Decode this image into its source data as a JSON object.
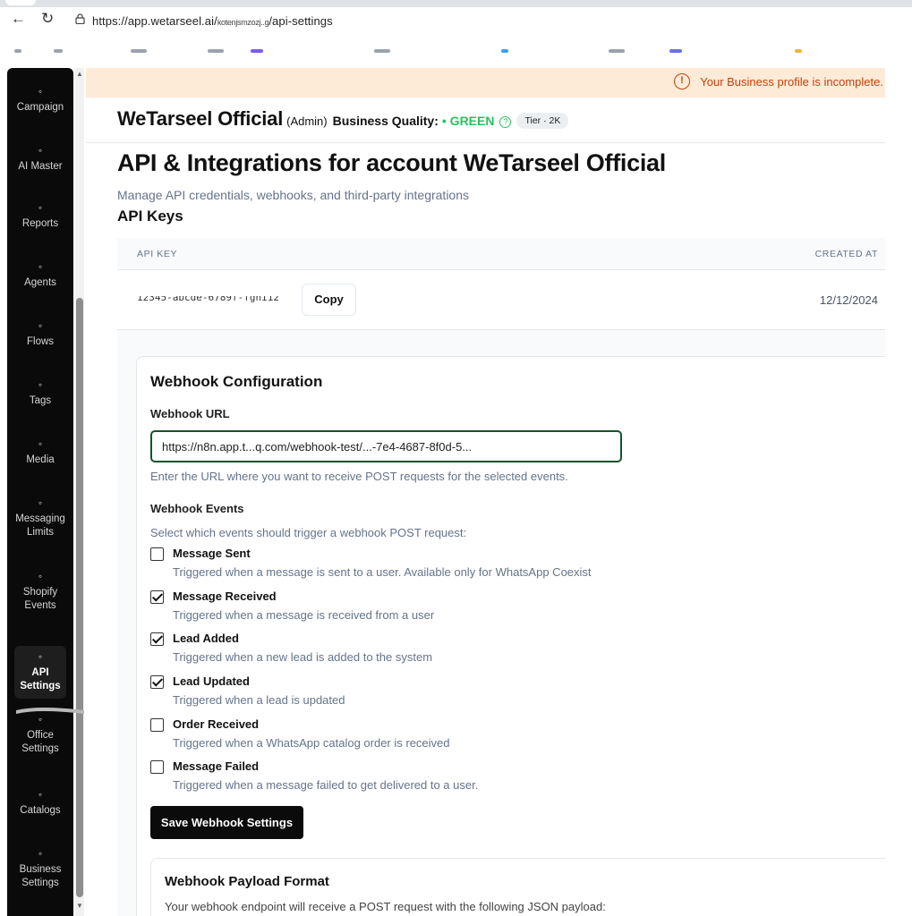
{
  "browser": {
    "url_host": "https://app.wetarseel.ai/",
    "url_mid": "kotenjsmzozj..g",
    "url_path": "/api-settings",
    "back_icon": "arrow-left",
    "reload_icon": "reload"
  },
  "sidebar": {
    "items": [
      {
        "label": "Campaign",
        "icon": "megaphone-icon"
      },
      {
        "label": "AI Master",
        "icon": "robot-icon"
      },
      {
        "label": "Reports",
        "icon": "report-icon"
      },
      {
        "label": "Agents",
        "icon": "agent-icon"
      },
      {
        "label": "Flows",
        "icon": "flow-icon"
      },
      {
        "label": "Tags",
        "icon": "tag-icon"
      },
      {
        "label": "Media",
        "icon": "image-icon"
      },
      {
        "label": "Messaging Limits",
        "icon": "chat-icon"
      },
      {
        "label": "Shopify Events",
        "icon": "bag-icon"
      },
      {
        "label": "API Settings",
        "icon": "plug-icon",
        "active": true
      },
      {
        "label": "Office Settings",
        "icon": "plug-icon"
      },
      {
        "label": "Catalogs",
        "icon": "store-icon"
      },
      {
        "label": "Business Settings",
        "icon": "gear-icon"
      }
    ]
  },
  "banner": {
    "text": "Your Business profile is incomplete."
  },
  "header": {
    "org": "WeTarseel Official",
    "role": "(Admin)",
    "quality_label": "Business Quality:",
    "quality_value": "• GREEN",
    "tier": "Tier · 2K"
  },
  "page": {
    "title": "API & Integrations for account WeTarseel Official",
    "subtitle": "Manage API credentials, webhooks, and third-party integrations",
    "api_keys_heading": "API Keys"
  },
  "api_table": {
    "col_key": "API KEY",
    "col_created": "CREATED AT",
    "rows": [
      {
        "key": "12345-abcde-6789f-fghi12",
        "copy_label": "Copy",
        "created": "12/12/2024"
      }
    ]
  },
  "webhook": {
    "title": "Webhook Configuration",
    "url_label": "Webhook URL",
    "url_value": "https://n8n.app.t...q.com/webhook-test/...-7e4-4687-8f0d-5...",
    "url_hint": "Enter the URL where you want to receive POST requests for the selected events.",
    "events_label": "Webhook Events",
    "events_hint": "Select which events should trigger a webhook POST request:",
    "events": [
      {
        "name": "Message Sent",
        "desc": "Triggered when a message is sent to a user. Available only for WhatsApp Coexist",
        "checked": false
      },
      {
        "name": "Message Received",
        "desc": "Triggered when a message is received from a user",
        "checked": true
      },
      {
        "name": "Lead Added",
        "desc": "Triggered when a new lead is added to the system",
        "checked": true
      },
      {
        "name": "Lead Updated",
        "desc": "Triggered when a lead is updated",
        "checked": true
      },
      {
        "name": "Order Received",
        "desc": "Triggered when a WhatsApp catalog order is received",
        "checked": false
      },
      {
        "name": "Message Failed",
        "desc": "Triggered when a message failed to get delivered to a user.",
        "checked": false
      }
    ],
    "save_label": "Save Webhook Settings"
  },
  "payload": {
    "title": "Webhook Payload Format",
    "desc": "Your webhook endpoint will receive a POST request with the following JSON payload:"
  }
}
